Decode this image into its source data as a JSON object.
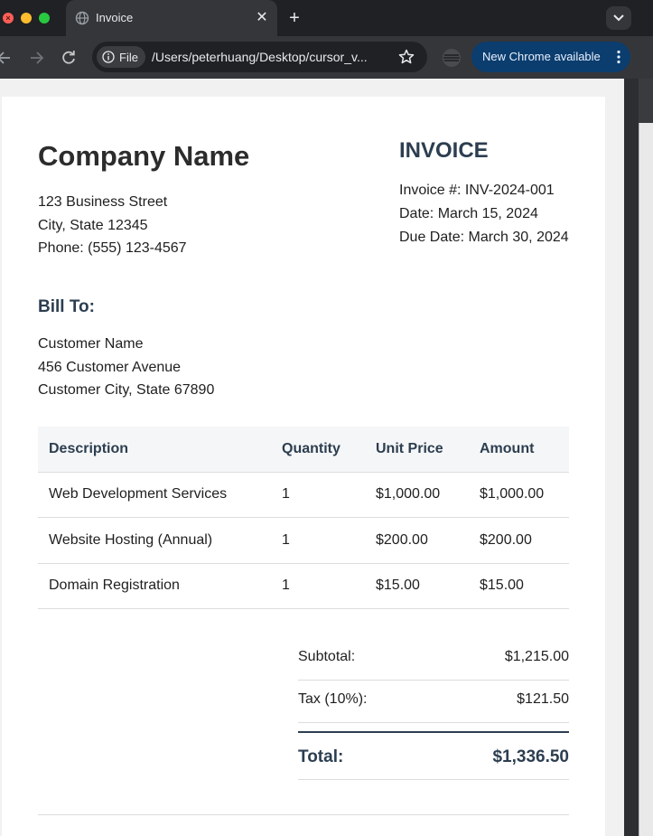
{
  "browser": {
    "tab": {
      "title": "Invoice",
      "favicon": "globe-icon"
    },
    "omnibox": {
      "scheme_chip": "File",
      "url": "/Users/peterhuang/Desktop/cursor_v..."
    },
    "update_button": {
      "label": "New Chrome available"
    },
    "colors": {
      "chrome_dark": "#202124",
      "toolbar": "#35363a",
      "update_bg": "#0b3d6e"
    }
  },
  "invoice": {
    "company": {
      "name": "Company Name",
      "street": "123 Business Street",
      "city": "City, State 12345",
      "phone": "Phone: (555) 123-4567"
    },
    "title": "INVOICE",
    "meta": {
      "number": "Invoice #: INV-2024-001",
      "date": "Date: March 15, 2024",
      "due": "Due Date: March 30, 2024"
    },
    "bill_to": {
      "heading": "Bill To:",
      "name": "Customer Name",
      "street": "456 Customer Avenue",
      "city": "Customer City, State 67890"
    },
    "table": {
      "headers": [
        "Description",
        "Quantity",
        "Unit Price",
        "Amount"
      ],
      "rows": [
        [
          "Web Development Services",
          "1",
          "$1,000.00",
          "$1,000.00"
        ],
        [
          "Website Hosting (Annual)",
          "1",
          "$200.00",
          "$200.00"
        ],
        [
          "Domain Registration",
          "1",
          "$15.00",
          "$15.00"
        ]
      ]
    },
    "totals": {
      "subtotal_label": "Subtotal:",
      "subtotal": "$1,215.00",
      "tax_label": "Tax (10%):",
      "tax": "$121.50",
      "total_label": "Total:",
      "total": "$1,336.50"
    },
    "colors": {
      "heading": "#2c3e50",
      "header_bg": "#f5f6f7",
      "rule": "#dcdcdc"
    }
  }
}
